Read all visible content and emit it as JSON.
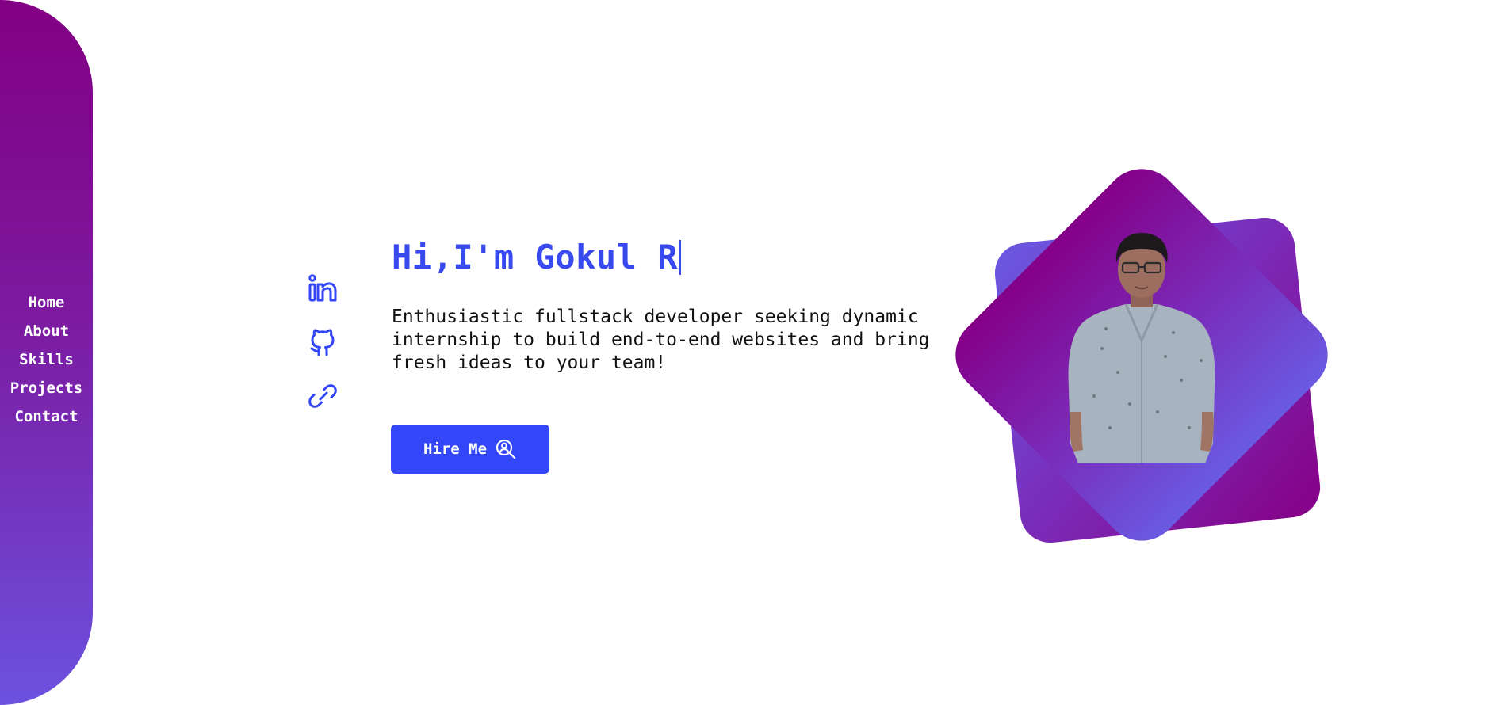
{
  "nav": {
    "items": [
      {
        "label": "Home"
      },
      {
        "label": "About"
      },
      {
        "label": "Skills"
      },
      {
        "label": "Projects"
      },
      {
        "label": "Contact"
      }
    ]
  },
  "socials": [
    {
      "icon": "linkedin-icon"
    },
    {
      "icon": "github-icon"
    },
    {
      "icon": "link-icon"
    }
  ],
  "hero": {
    "greeting": "Hi,I'm Gokul R",
    "description": "Enthusiastic fullstack developer seeking dynamic internship to build end-to-end websites and bring fresh ideas to your team!",
    "button_label": "Hire Me",
    "button_icon": "user-search-icon"
  },
  "colors": {
    "accent": "#3346f8",
    "sidebar_top": "#820083",
    "sidebar_bottom": "#6b52df"
  }
}
